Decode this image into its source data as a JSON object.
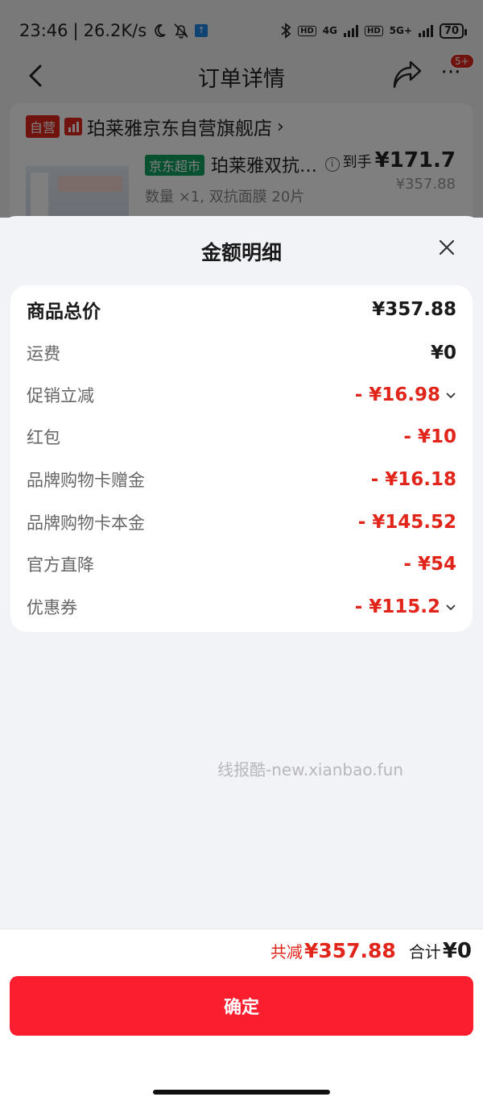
{
  "status_bar": {
    "time": "23:46",
    "speed": "26.2K/s",
    "net_4g": "4G",
    "net_5g": "5G+",
    "hd1": "HD",
    "hd2": "HD",
    "battery": "70"
  },
  "nav": {
    "title": "订单详情",
    "badge": "5+"
  },
  "store": {
    "self_tag": "自营",
    "name": "珀莱雅京东自营旗舰店",
    "arrow": "›",
    "market_tag": "京东超市",
    "product_name": "珀莱雅双抗…",
    "product_meta": "数量 ×1, 双抗面膜 20片",
    "price_prefix": "到手",
    "price_now": "¥171.7",
    "price_old": "¥357.88"
  },
  "sheet": {
    "title": "金额明细",
    "rows": [
      {
        "label": "商品总价",
        "value": "¥357.88"
      },
      {
        "label": "运费",
        "value": "¥0"
      },
      {
        "label": "促销立减",
        "value": "- ¥16.98"
      },
      {
        "label": "红包",
        "value": "- ¥10"
      },
      {
        "label": "品牌购物卡赠金",
        "value": "- ¥16.18"
      },
      {
        "label": "品牌购物卡本金",
        "value": "- ¥145.52"
      },
      {
        "label": "官方直降",
        "value": "- ¥54"
      },
      {
        "label": "优惠券",
        "value": "- ¥115.2"
      }
    ],
    "watermark": "线报酷-new.xianbao.fun"
  },
  "footer": {
    "discount_label": "共减",
    "discount_value": "¥357.88",
    "total_label": "合计",
    "total_value": "¥0",
    "confirm_label": "确定"
  },
  "colors": {
    "accent_red": "#e1251b",
    "button_red": "#fa1e2e",
    "market_green": "#0fa160"
  },
  "icons": [
    "back-arrow-icon",
    "share-icon",
    "more-icon",
    "bluetooth-icon",
    "moon-icon",
    "bell-off-icon",
    "close-icon",
    "chevron-down-icon",
    "info-icon"
  ]
}
